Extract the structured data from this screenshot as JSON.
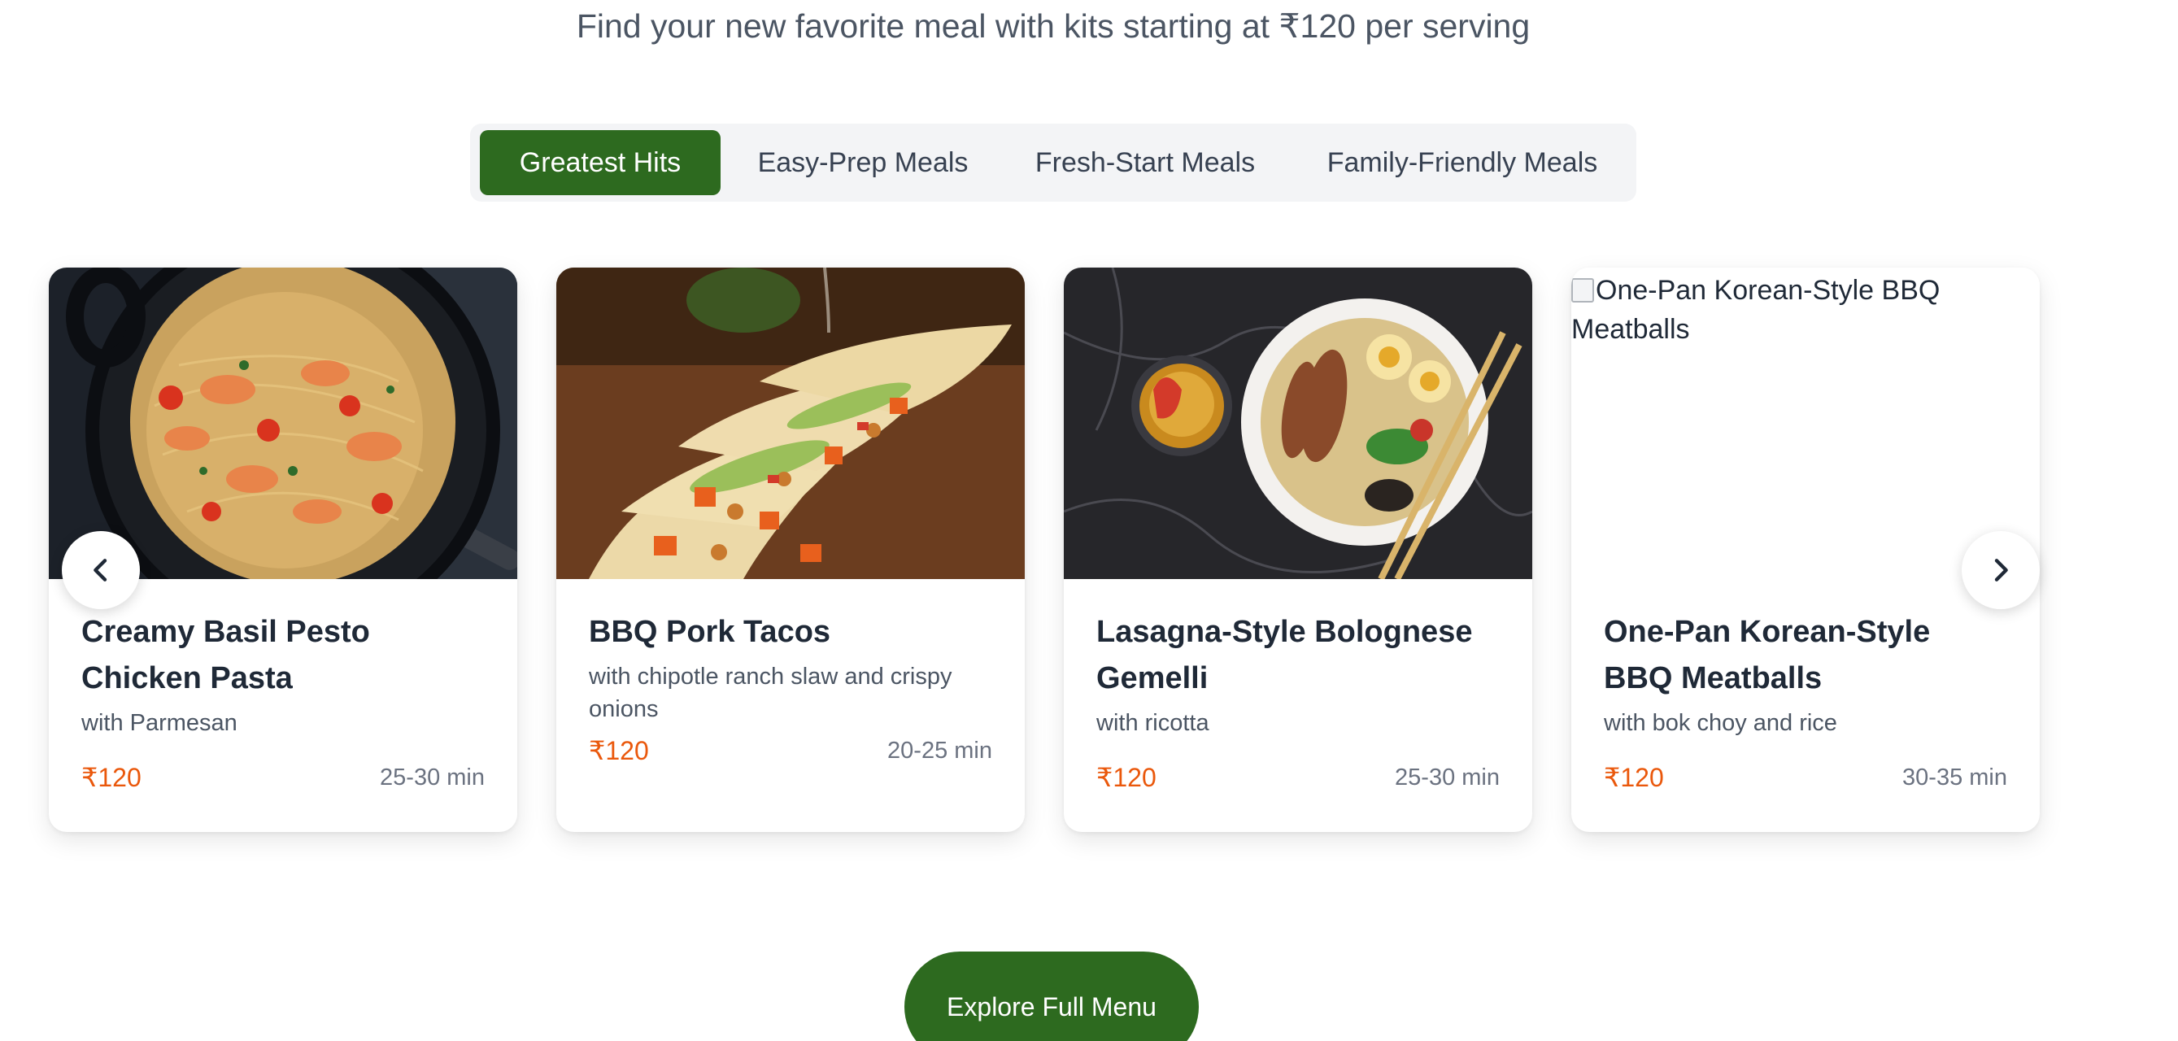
{
  "header": {
    "subtitle": "Find your new favorite meal with kits starting at ₹120 per serving"
  },
  "tabs": [
    {
      "label": "Greatest Hits",
      "active": true
    },
    {
      "label": "Easy-Prep Meals",
      "active": false
    },
    {
      "label": "Fresh-Start Meals",
      "active": false
    },
    {
      "label": "Family-Friendly Meals",
      "active": false
    }
  ],
  "carousel": {
    "prev_icon": "chevron-left-icon",
    "next_icon": "chevron-right-icon",
    "cards": [
      {
        "title": "Creamy Basil Pesto Chicken Pasta",
        "subtitle": "with Parmesan",
        "price": "₹120",
        "time": "25-30 min",
        "image": "shrimp-spaghetti-pan"
      },
      {
        "title": "BBQ Pork Tacos",
        "subtitle": "with chipotle ranch slaw and crispy onions",
        "price": "₹120",
        "time": "20-25 min",
        "image": "tacos"
      },
      {
        "title": "Lasagna-Style Bolognese Gemelli",
        "subtitle": "with ricotta",
        "price": "₹120",
        "time": "25-30 min",
        "image": "ramen-bowl"
      },
      {
        "title": "One-Pan Korean-Style BBQ Meatballs",
        "subtitle": "with bok choy and rice",
        "price": "₹120",
        "time": "30-35 min",
        "image_alt": "One-Pan Korean-Style BBQ Meatballs",
        "image_broken": true
      }
    ]
  },
  "cta": {
    "label": "Explore Full Menu"
  },
  "colors": {
    "brand_green": "#2d6a1f",
    "price_orange": "#ea580c",
    "tab_bg": "#f3f4f6"
  }
}
